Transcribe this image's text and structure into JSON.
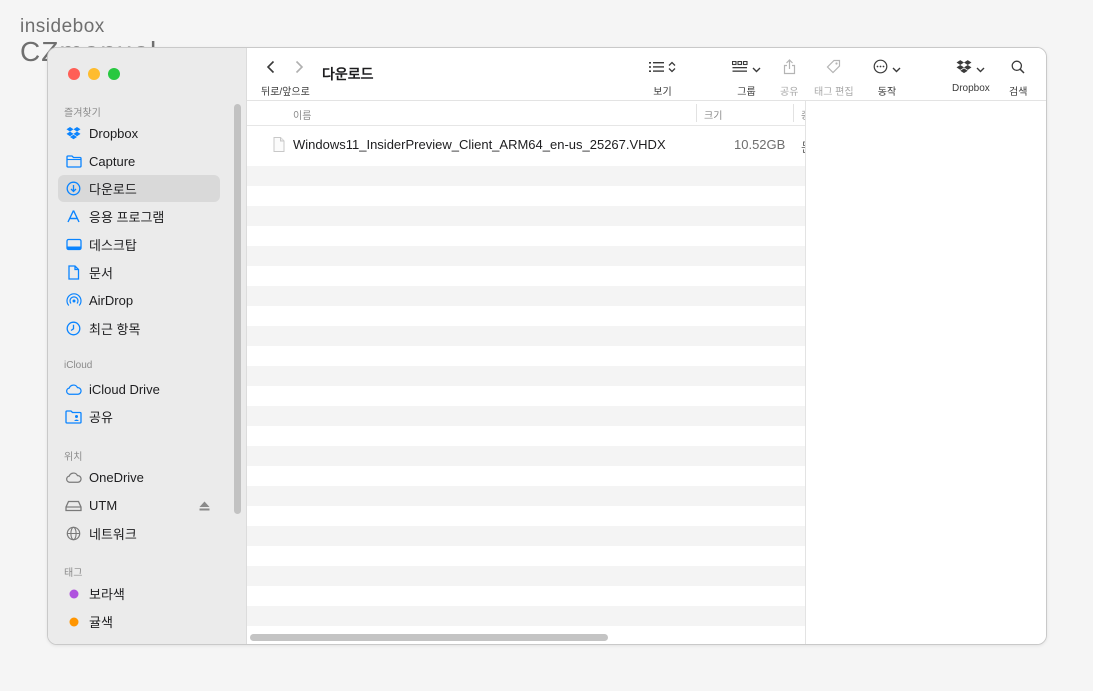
{
  "watermark": {
    "line1": "insidebox",
    "line2": "CZmanual"
  },
  "window": {
    "title": "다운로드",
    "traffic": {
      "close": "#ff5f57",
      "minimize": "#febc2e",
      "zoom": "#28c840"
    }
  },
  "toolbar": {
    "nav_label": "뒤로/앞으로",
    "view_label": "보기",
    "group_label": "그룹",
    "share_label": "공유",
    "tags_label": "태그 편집",
    "action_label": "동작",
    "dropbox_label": "Dropbox",
    "search_label": "검색"
  },
  "sidebar": {
    "favorites_label": "즐겨찾기",
    "favorites": [
      {
        "label": "Dropbox",
        "icon": "dropbox-icon"
      },
      {
        "label": "Capture",
        "icon": "folder-icon"
      },
      {
        "label": "다운로드",
        "icon": "download-icon",
        "selected": true
      },
      {
        "label": "응용 프로그램",
        "icon": "applications-icon"
      },
      {
        "label": "데스크탑",
        "icon": "desktop-icon"
      },
      {
        "label": "문서",
        "icon": "document-icon"
      },
      {
        "label": "AirDrop",
        "icon": "airdrop-icon"
      },
      {
        "label": "최근 항목",
        "icon": "clock-icon"
      }
    ],
    "icloud_label": "iCloud",
    "icloud": [
      {
        "label": "iCloud Drive",
        "icon": "cloud-icon"
      },
      {
        "label": "공유",
        "icon": "shared-folder-icon"
      }
    ],
    "locations_label": "위치",
    "locations": [
      {
        "label": "OneDrive",
        "icon": "cloud-icon"
      },
      {
        "label": "UTM",
        "icon": "drive-icon",
        "eject": true
      },
      {
        "label": "네트워크",
        "icon": "globe-icon"
      }
    ],
    "tags_label": "태그",
    "tags": [
      {
        "label": "보라색",
        "color": "#af52de"
      },
      {
        "label": "귤색",
        "color": "#ff9500"
      }
    ]
  },
  "columns": {
    "name": "이름",
    "size": "크기",
    "kind": "종"
  },
  "files": [
    {
      "name": "Windows11_InsiderPreview_Client_ARM64_en-us_25267.VHDX",
      "size": "10.52GB",
      "kind": "문"
    }
  ]
}
